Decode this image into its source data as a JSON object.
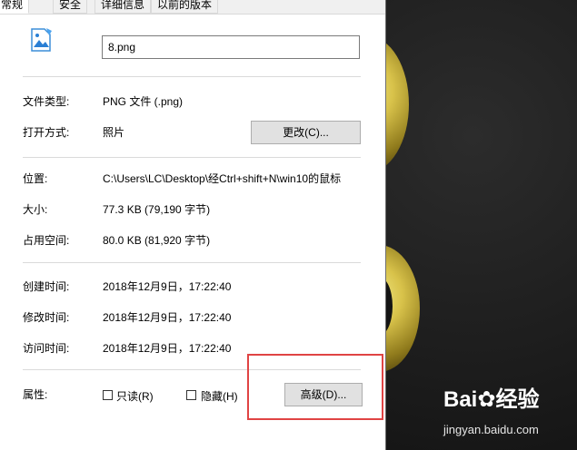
{
  "tabs": [
    "常规",
    "安全",
    "详细信息",
    "以前的版本"
  ],
  "file": {
    "name": "8.png"
  },
  "labels": {
    "type": "文件类型:",
    "open_with": "打开方式:",
    "location": "位置:",
    "size": "大小:",
    "size_on_disk": "占用空间:",
    "created": "创建时间:",
    "modified": "修改时间:",
    "accessed": "访问时间:",
    "attributes": "属性:"
  },
  "values": {
    "type": "PNG 文件 (.png)",
    "open_with": "照片",
    "location": "C:\\Users\\LC\\Desktop\\经Ctrl+shift+N\\win10的鼠标",
    "size": "77.3 KB (79,190 字节)",
    "size_on_disk": "80.0 KB (81,920 字节)",
    "created": "2018年12月9日，17:22:40",
    "modified": "2018年12月9日，17:22:40",
    "accessed": "2018年12月9日，17:22:40"
  },
  "buttons": {
    "change": "更改(C)...",
    "advanced": "高级(D)..."
  },
  "checkboxes": {
    "readonly": "只读(R)",
    "hidden": "隐藏(H)"
  },
  "watermark": {
    "brand": "Bai",
    "brand_suffix": "经验",
    "url": "jingyan.baidu.com"
  },
  "colors": {
    "highlight": "#e04444",
    "button_bg": "#e1e1e1"
  },
  "icons": {
    "file": "image-file-icon"
  }
}
